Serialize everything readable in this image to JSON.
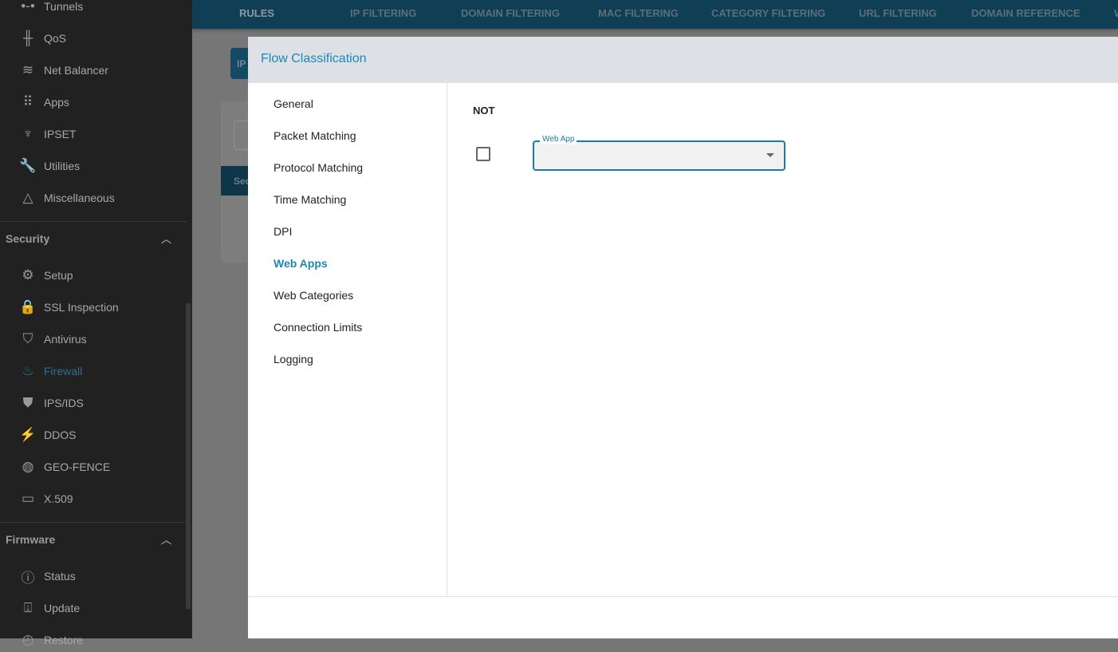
{
  "sidebar": {
    "items_top": [
      {
        "label": "Tunnels",
        "icon": "tunnels-icon",
        "glyph": "•-•"
      },
      {
        "label": "QoS",
        "icon": "qos-icon",
        "glyph": "╫"
      },
      {
        "label": "Net Balancer",
        "icon": "waves-icon",
        "glyph": "≋"
      },
      {
        "label": "Apps",
        "icon": "apps-grid-icon",
        "glyph": "⠿"
      },
      {
        "label": "IPSET",
        "icon": "lamp-icon",
        "glyph": "♆"
      },
      {
        "label": "Utilities",
        "icon": "wrench-icon",
        "glyph": "🔧"
      },
      {
        "label": "Miscellaneous",
        "icon": "shapes-icon",
        "glyph": "△"
      }
    ],
    "security": {
      "title": "Security",
      "items": [
        {
          "label": "Setup",
          "icon": "setup-icon",
          "glyph": "⚙"
        },
        {
          "label": "SSL Inspection",
          "icon": "lock-icon",
          "glyph": "🔒"
        },
        {
          "label": "Antivirus",
          "icon": "shield-check-icon",
          "glyph": "⛉"
        },
        {
          "label": "Firewall",
          "icon": "fire-icon",
          "glyph": "♨"
        },
        {
          "label": "IPS/IDS",
          "icon": "shield-icon",
          "glyph": "⛊"
        },
        {
          "label": "DDOS",
          "icon": "ddos-icon",
          "glyph": "⚡"
        },
        {
          "label": "GEO-FENCE",
          "icon": "globe-icon",
          "glyph": "◍"
        },
        {
          "label": "X.509",
          "icon": "certificate-icon",
          "glyph": "▭"
        }
      ]
    },
    "firmware": {
      "title": "Firmware",
      "items": [
        {
          "label": "Status",
          "icon": "info-icon",
          "glyph": "ⓘ"
        },
        {
          "label": "Update",
          "icon": "download-icon",
          "glyph": "⍗"
        },
        {
          "label": "Restore",
          "icon": "restore-icon",
          "glyph": "◴"
        }
      ]
    }
  },
  "nav_tabs": [
    "RULES",
    "IP FILTERING",
    "DOMAIN FILTERING",
    "MAC FILTERING",
    "CATEGORY FILTERING",
    "URL FILTERING",
    "DOMAIN REFERENCE",
    "W"
  ],
  "background": {
    "button_label": "IP",
    "section_label": "Sec"
  },
  "modal": {
    "title": "Flow Classification",
    "nav": [
      "General",
      "Packet Matching",
      "Protocol Matching",
      "Time Matching",
      "DPI",
      "Web Apps",
      "Web Categories",
      "Connection Limits",
      "Logging"
    ],
    "active_nav": "Web Apps",
    "not_label": "NOT",
    "not_checked": false,
    "web_app_label": "Web App",
    "web_app_value": ""
  },
  "colors": {
    "accent": "#1f86ba",
    "sidebar_bg": "#212121",
    "nav_bg": "#0f3e55"
  }
}
